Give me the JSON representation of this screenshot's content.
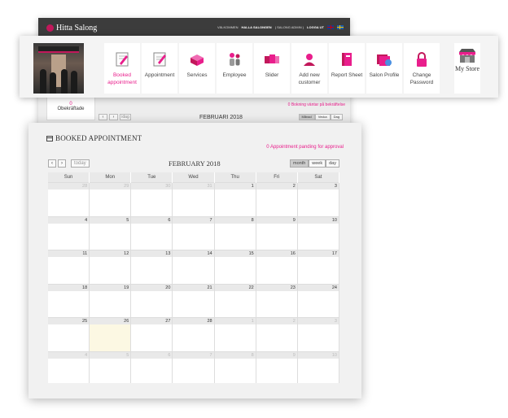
{
  "background_window": {
    "logo_text": "Hitta Salong",
    "top_links": [
      "VÄLKOMMEN",
      "HALLA SALONGEN",
      "( SALONG ADMIN )",
      "LOGGA UT"
    ],
    "stat_value": "0",
    "stat_label": "Obekräftade",
    "pending_text": "0 Bokning väntar på bekräftelse",
    "month_label": "FEBRUARI 2018",
    "nav_prev": "‹",
    "nav_next": "›",
    "today_label": "idag",
    "views": [
      "Månad",
      "Vecka",
      "Dag"
    ]
  },
  "toolbar": {
    "items": [
      {
        "label": "Booked appointment",
        "icon": "clipboard-pencil-icon",
        "active": true
      },
      {
        "label": "Appointment",
        "icon": "notepad-icon",
        "active": false
      },
      {
        "label": "Services",
        "icon": "beauty-kit-icon",
        "active": false
      },
      {
        "label": "Employee",
        "icon": "people-icon",
        "active": false
      },
      {
        "label": "Slider",
        "icon": "slides-icon",
        "active": false
      },
      {
        "label": "Add new customer",
        "icon": "user-icon",
        "active": false
      },
      {
        "label": "Report Sheet",
        "icon": "book-icon",
        "active": false
      },
      {
        "label": "Salon Profile",
        "icon": "folders-icon",
        "active": false
      },
      {
        "label": "Change Password",
        "icon": "lock-icon",
        "active": false
      }
    ],
    "my_store_label": "My Store",
    "accent_color": "#e91e8c"
  },
  "calendar_panel": {
    "title": "BOOKED APPOINTMENT",
    "pending_text": "0 Appointment panding for approval",
    "nav_prev": "‹",
    "nav_next": "›",
    "today_label": "today",
    "month_label": "FEBRUARY 2018",
    "views": [
      {
        "label": "month",
        "active": true
      },
      {
        "label": "week",
        "active": false
      },
      {
        "label": "day",
        "active": false
      }
    ],
    "weekdays": [
      "Sun",
      "Mon",
      "Tue",
      "Wed",
      "Thu",
      "Fri",
      "Sat"
    ],
    "weeks": [
      [
        {
          "d": "28",
          "o": true
        },
        {
          "d": "29",
          "o": true
        },
        {
          "d": "30",
          "o": true
        },
        {
          "d": "31",
          "o": true
        },
        {
          "d": "1"
        },
        {
          "d": "2"
        },
        {
          "d": "3"
        }
      ],
      [
        {
          "d": "4"
        },
        {
          "d": "5"
        },
        {
          "d": "6"
        },
        {
          "d": "7"
        },
        {
          "d": "8"
        },
        {
          "d": "9"
        },
        {
          "d": "10"
        }
      ],
      [
        {
          "d": "11"
        },
        {
          "d": "12"
        },
        {
          "d": "13"
        },
        {
          "d": "14"
        },
        {
          "d": "15"
        },
        {
          "d": "16"
        },
        {
          "d": "17"
        }
      ],
      [
        {
          "d": "18"
        },
        {
          "d": "19"
        },
        {
          "d": "20"
        },
        {
          "d": "21"
        },
        {
          "d": "22"
        },
        {
          "d": "23"
        },
        {
          "d": "24"
        }
      ],
      [
        {
          "d": "25"
        },
        {
          "d": "26",
          "today": true
        },
        {
          "d": "27"
        },
        {
          "d": "28"
        },
        {
          "d": "1",
          "o": true
        },
        {
          "d": "2",
          "o": true
        },
        {
          "d": "3",
          "o": true
        }
      ],
      [
        {
          "d": "4",
          "o": true
        },
        {
          "d": "5",
          "o": true
        },
        {
          "d": "6",
          "o": true
        },
        {
          "d": "7",
          "o": true
        },
        {
          "d": "8",
          "o": true
        },
        {
          "d": "9",
          "o": true
        },
        {
          "d": "10",
          "o": true
        }
      ]
    ],
    "today_highlight_color": "#fcf8e3"
  }
}
